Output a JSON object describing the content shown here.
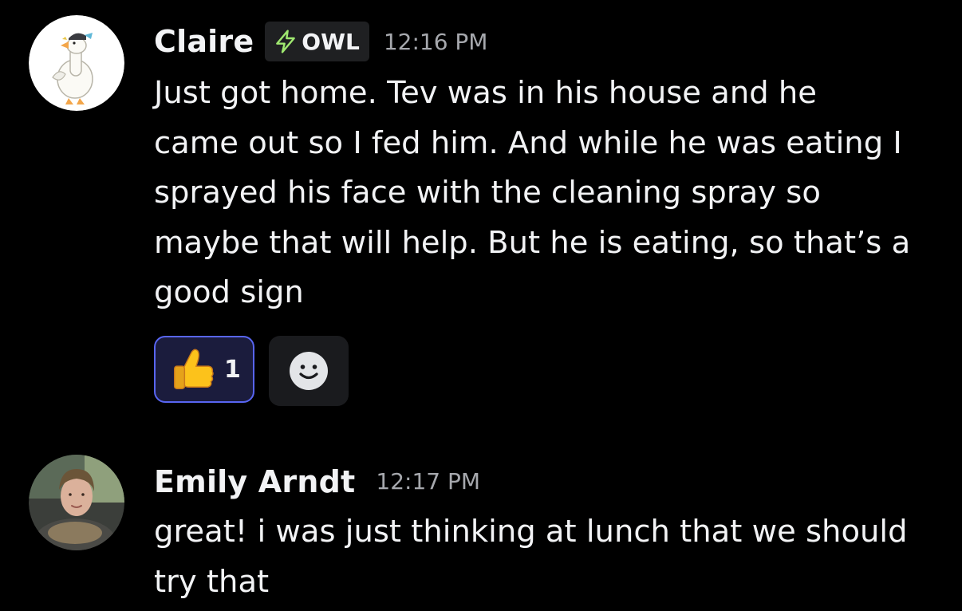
{
  "messages": [
    {
      "author": "Claire",
      "tag": "OWL",
      "timestamp": "12:16 PM",
      "avatar": "white-goose-avatar",
      "lines": [
        "Just got home. Tev was in his house and he",
        "came out so I fed him. And while he was eating I",
        "sprayed his face with the cleaning spray so",
        "maybe that will help. But he is eating, so that’s a",
        "good sign"
      ],
      "reactions": [
        {
          "emoji": "thumbs-up",
          "count": "1",
          "selected": true
        }
      ]
    },
    {
      "author": "Emily Arndt",
      "timestamp": "12:17 PM",
      "avatar": "user-photo-avatar",
      "lines": [
        "great! i was just thinking at lunch that we should",
        "try that"
      ]
    }
  ],
  "colors": {
    "background": "#000000",
    "text": "#f2f3f5",
    "muted": "#a6a8ad",
    "accent": "#5865f2",
    "tag_icon": "#9fe870"
  },
  "icons": {
    "tag": "lightning-bolt-icon",
    "reaction": "thumbs-up-emoji",
    "add_reaction": "smiley-face-icon"
  }
}
